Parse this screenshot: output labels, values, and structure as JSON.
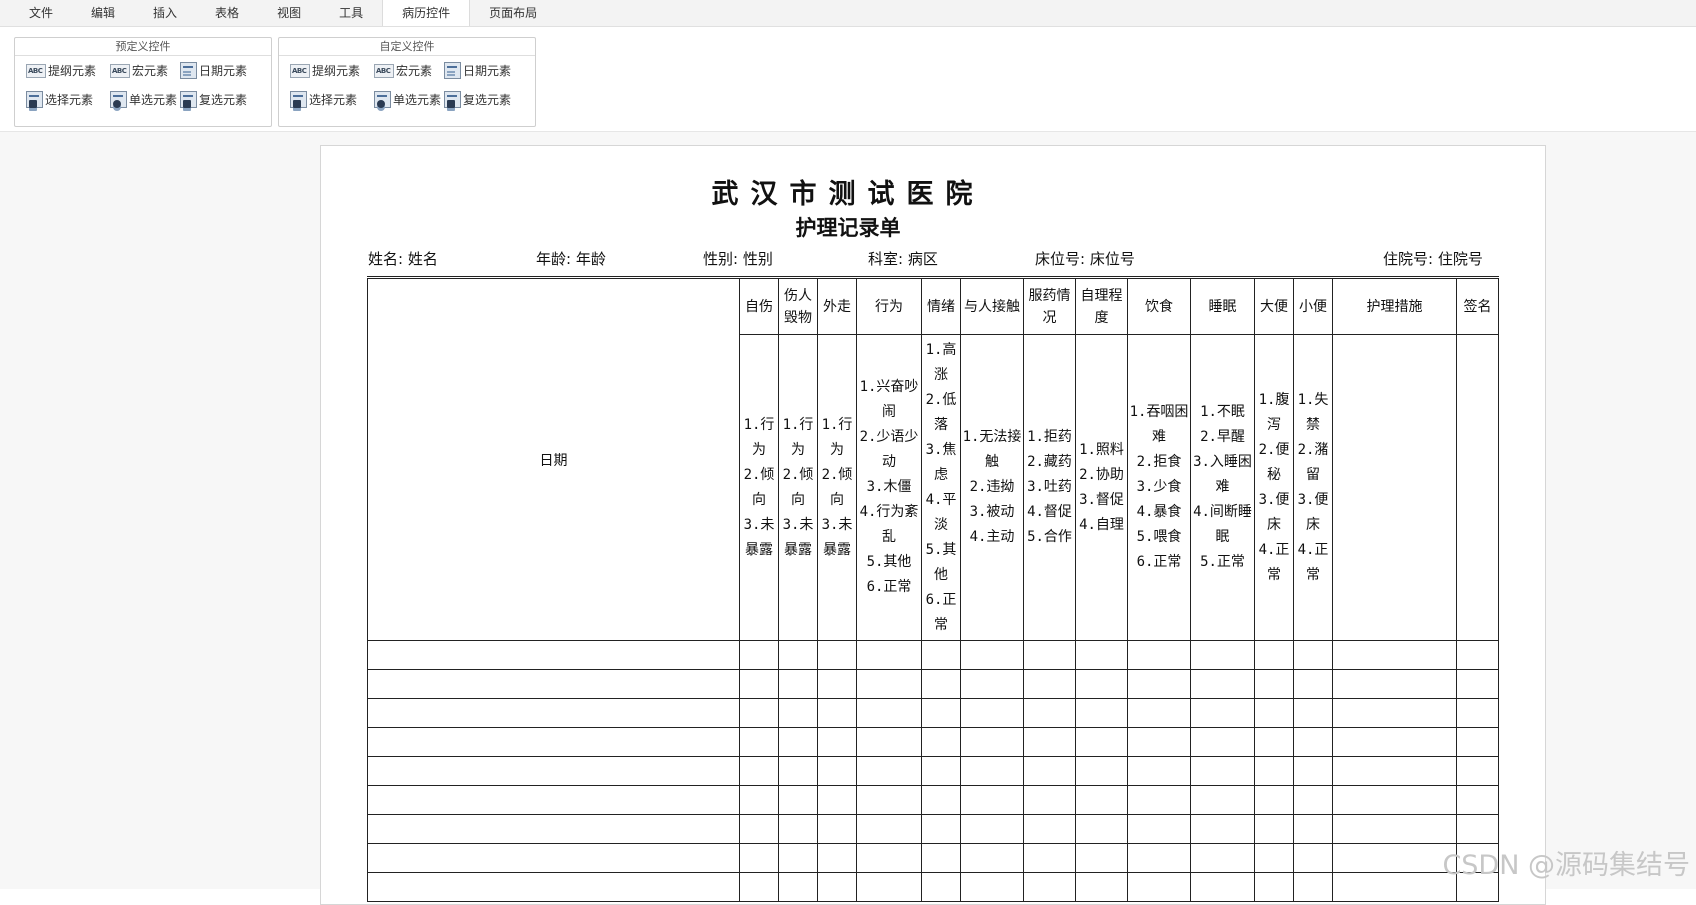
{
  "menu": {
    "tabs": [
      "文件",
      "编辑",
      "插入",
      "表格",
      "视图",
      "工具",
      "病历控件",
      "页面布局"
    ],
    "active_index": 6
  },
  "ribbon": {
    "groups": [
      {
        "title": "预定义控件",
        "buttons": [
          {
            "label": "提纲元素",
            "icon": "abc-text-icon"
          },
          {
            "label": "宏元素",
            "icon": "abc-text-icon"
          },
          {
            "label": "日期元素",
            "icon": "date-doc-icon"
          },
          {
            "label": "选择元素",
            "icon": "select-doc-icon"
          },
          {
            "label": "单选元素",
            "icon": "radio-doc-icon"
          },
          {
            "label": "复选元素",
            "icon": "checkbox-doc-icon"
          }
        ]
      },
      {
        "title": "自定义控件",
        "buttons": [
          {
            "label": "提纲元素",
            "icon": "abc-text-icon"
          },
          {
            "label": "宏元素",
            "icon": "abc-text-icon"
          },
          {
            "label": "日期元素",
            "icon": "date-doc-icon"
          },
          {
            "label": "选择元素",
            "icon": "select-doc-icon"
          },
          {
            "label": "单选元素",
            "icon": "radio-doc-icon"
          },
          {
            "label": "复选元素",
            "icon": "checkbox-doc-icon"
          }
        ]
      }
    ]
  },
  "document": {
    "hospital_name": "武汉市测试医院",
    "form_title": "护理记录单",
    "info": [
      "姓名: 姓名",
      "年龄: 年龄",
      "性别: 性别",
      "科室: 病区",
      "床位号: 床位号",
      "住院号: 住院号"
    ],
    "table": {
      "date_label": "日期",
      "headers": [
        "自伤",
        "伤人毁物",
        "外走",
        "行为",
        "情绪",
        "与人接触",
        "服药情况",
        "自理程度",
        "饮食",
        "睡眠",
        "大便",
        "小便",
        "护理措施",
        "签名"
      ],
      "options": [
        "1.行为\n2.倾向\n3.未暴露",
        "1.行为\n2.倾向\n3.未暴露",
        "1.行为\n2.倾向\n3.未暴露",
        "1.兴奋吵闹\n2.少语少动\n3.木僵\n4.行为紊乱\n5.其他\n6.正常",
        "1.高涨\n2.低落\n3.焦虑\n4.平淡\n5.其他\n6.正常",
        "1.无法接触\n2.违拗\n3.被动\n4.主动",
        "1.拒药\n2.藏药\n3.吐药\n4.督促\n5.合作",
        "1.照料\n2.协助\n3.督促\n4.自理",
        "1.吞咽困难\n2.拒食\n3.少食\n4.暴食\n5.喂食\n6.正常",
        "1.不眠\n2.早醒\n3.入睡困难\n4.间断睡眠\n5.正常",
        "1.腹泻\n2.便秘\n3.便床\n4.正常",
        "1.失禁\n2.潴留\n3.便床\n4.正常",
        "",
        ""
      ],
      "empty_rows": 9
    }
  },
  "watermark": "CSDN @源码集结号"
}
